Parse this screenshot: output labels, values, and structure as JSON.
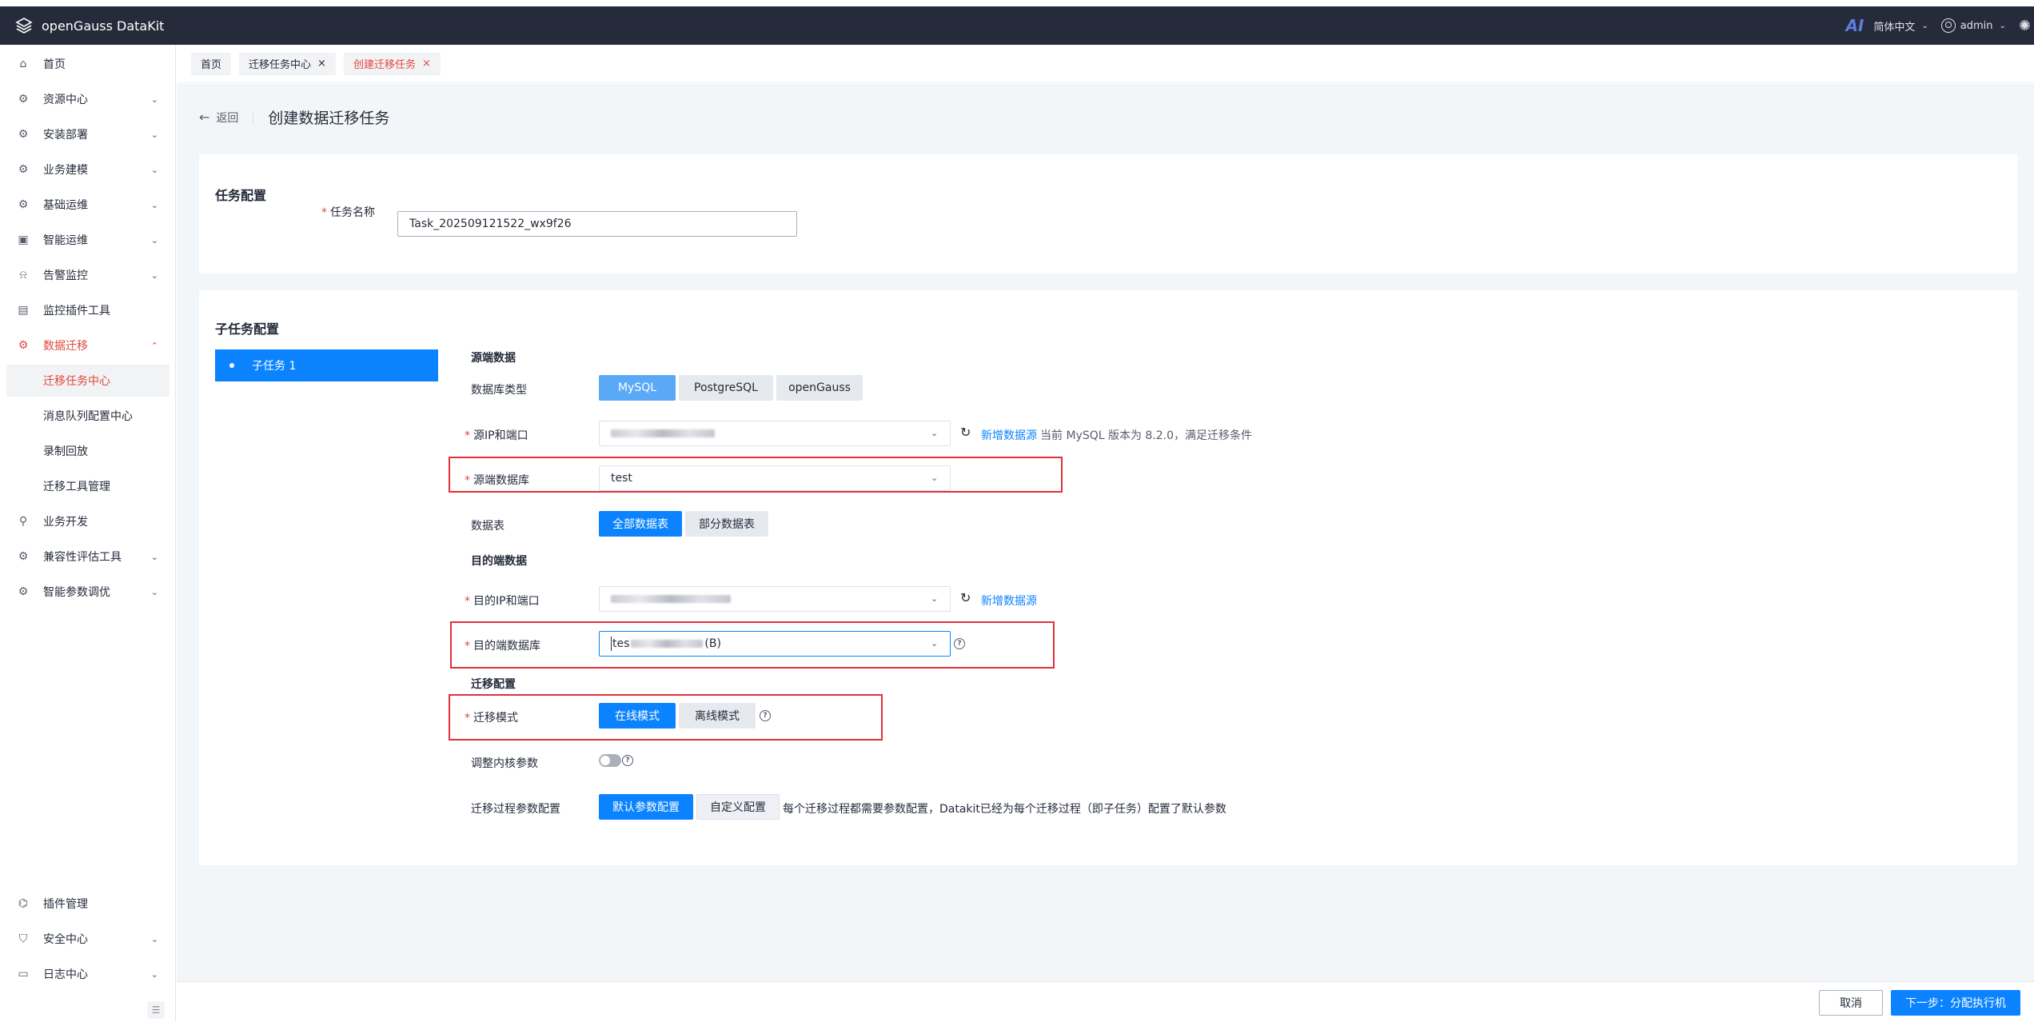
{
  "header": {
    "app_title": "openGauss DataKit",
    "ai_label": "AI",
    "language": "简体中文",
    "user": "admin"
  },
  "sidebar": {
    "items": [
      {
        "label": "首页",
        "icon": "home-icon"
      },
      {
        "label": "资源中心",
        "icon": "gear-icon"
      },
      {
        "label": "安装部署",
        "icon": "gear-icon"
      },
      {
        "label": "业务建模",
        "icon": "gear-icon"
      },
      {
        "label": "基础运维",
        "icon": "gear-icon"
      },
      {
        "label": "智能运维",
        "icon": "monitor-icon"
      },
      {
        "label": "告警监控",
        "icon": "alarm-icon"
      },
      {
        "label": "监控插件工具",
        "icon": "chart-icon"
      },
      {
        "label": "数据迁移",
        "icon": "gear-icon"
      },
      {
        "label": "业务开发",
        "icon": "search-icon"
      },
      {
        "label": "兼容性评估工具",
        "icon": "gear-icon"
      },
      {
        "label": "智能参数调优",
        "icon": "gear-icon"
      }
    ],
    "sub_items": [
      {
        "label": "迁移任务中心"
      },
      {
        "label": "消息队列配置中心"
      },
      {
        "label": "录制回放"
      },
      {
        "label": "迁移工具管理"
      }
    ],
    "bottom_items": [
      {
        "label": "插件管理",
        "icon": "plugin-icon"
      },
      {
        "label": "安全中心",
        "icon": "shield-icon"
      },
      {
        "label": "日志中心",
        "icon": "log-icon"
      }
    ]
  },
  "tabs": [
    {
      "label": "首页"
    },
    {
      "label": "迁移任务中心"
    },
    {
      "label": "创建迁移任务"
    }
  ],
  "page": {
    "back_label": "返回",
    "title": "创建数据迁移任务"
  },
  "task_config": {
    "section_title": "任务配置",
    "name_label": "任务名称",
    "name_value": "Task_202509121522_wx9f26"
  },
  "subtask_config": {
    "section_title": "子任务配置",
    "subtask_item": "子任务 1",
    "source": {
      "group_title": "源端数据",
      "db_type_label": "数据库类型",
      "db_types": [
        "MySQL",
        "PostgreSQL",
        "openGauss"
      ],
      "ip_label": "源IP和端口",
      "new_datasource": "新增数据源",
      "version_note": "当前 MySQL 版本为 8.2.0，满足迁移条件",
      "db_label": "源端数据库",
      "db_value": "test",
      "table_label": "数据表",
      "table_options": [
        "全部数据表",
        "部分数据表"
      ]
    },
    "target": {
      "group_title": "目的端数据",
      "ip_label": "目的IP和端口",
      "new_datasource": "新增数据源",
      "db_label": "目的端数据库",
      "db_value_prefix": "tes",
      "db_value_suffix": "(B)"
    },
    "migration": {
      "group_title": "迁移配置",
      "mode_label": "迁移模式",
      "modes": [
        "在线模式",
        "离线模式"
      ],
      "kernel_label": "调整内核参数",
      "process_label": "迁移过程参数配置",
      "process_options": [
        "默认参数配置",
        "自定义配置"
      ],
      "process_note": "每个迁移过程都需要参数配置，Datakit已经为每个迁移过程（即子任务）配置了默认参数"
    }
  },
  "footer": {
    "cancel": "取消",
    "next": "下一步：分配执行机"
  },
  "colors": {
    "header_bg": "#252b3a",
    "accent": "#0b83ff",
    "active_red": "#e0483c",
    "highlight_box": "#e0303a"
  }
}
